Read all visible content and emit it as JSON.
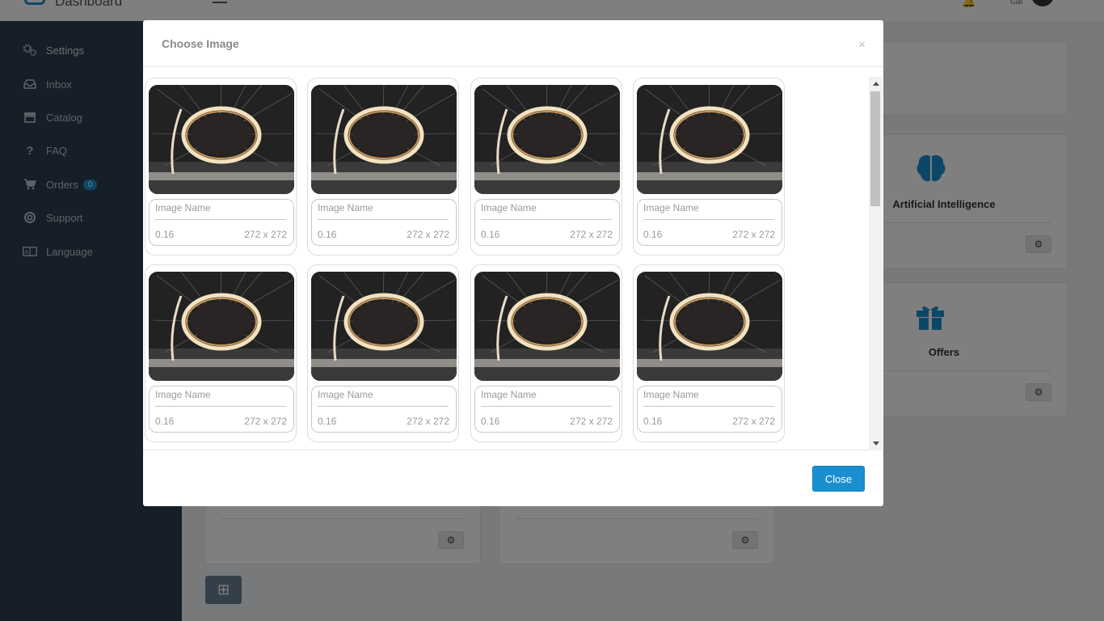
{
  "app": {
    "title": "Dashboard",
    "user_name": "cal"
  },
  "sidebar": {
    "items": [
      {
        "label": "Settings",
        "icon": "gears-icon"
      },
      {
        "label": "Inbox",
        "icon": "inbox-icon"
      },
      {
        "label": "Catalog",
        "icon": "store-icon"
      },
      {
        "label": "FAQ",
        "icon": "question-icon"
      },
      {
        "label": "Orders",
        "icon": "cart-icon",
        "badge": "0"
      },
      {
        "label": "Support",
        "icon": "lifebuoy-icon"
      },
      {
        "label": "Language",
        "icon": "language-icon"
      }
    ]
  },
  "cards": {
    "ai_title": "Artificial Intelligence",
    "offers_title": "Offers"
  },
  "modal": {
    "title": "Choose Image",
    "close_x": "×",
    "close_label": "Close",
    "images": [
      {
        "name": "Image Name",
        "size": "0.16",
        "dimensions": "272 x 272"
      },
      {
        "name": "Image Name",
        "size": "0.16",
        "dimensions": "272 x 272"
      },
      {
        "name": "Image Name",
        "size": "0.16",
        "dimensions": "272 x 272"
      },
      {
        "name": "Image Name",
        "size": "0.16",
        "dimensions": "272 x 272"
      },
      {
        "name": "Image Name",
        "size": "0.16",
        "dimensions": "272 x 272"
      },
      {
        "name": "Image Name",
        "size": "0.16",
        "dimensions": "272 x 272"
      },
      {
        "name": "Image Name",
        "size": "0.16",
        "dimensions": "272 x 272"
      },
      {
        "name": "Image Name",
        "size": "0.16",
        "dimensions": "272 x 272"
      }
    ]
  },
  "colors": {
    "accent": "#1a8fd0",
    "sidebar_bg": "#2c3e50",
    "overlay": "rgba(0,0,0,0.5)"
  }
}
